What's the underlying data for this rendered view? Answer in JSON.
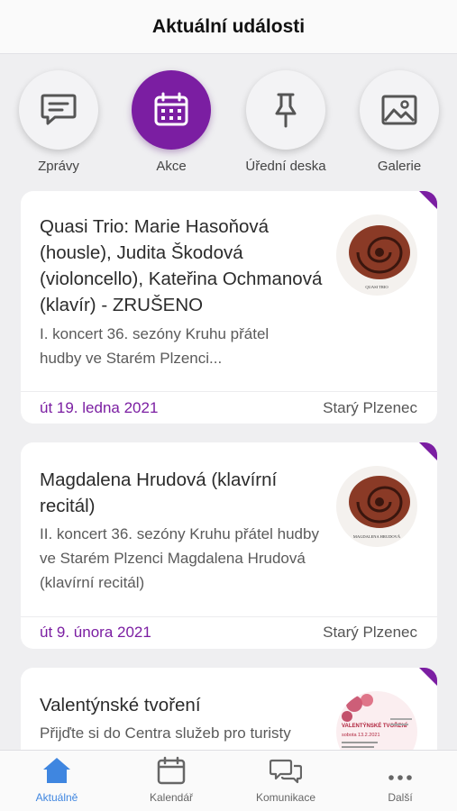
{
  "header": {
    "title": "Aktuální události"
  },
  "categories": [
    {
      "label": "Zprávy",
      "icon": "message-icon"
    },
    {
      "label": "Akce",
      "icon": "calendar-icon"
    },
    {
      "label": "Úřední deska",
      "icon": "pin-icon"
    },
    {
      "label": "Galerie",
      "icon": "image-icon"
    }
  ],
  "events": [
    {
      "title": "Quasi Trio: Marie Hasoňová (housle), Judita Škodová (violoncello), Kateřina Ochmanová (klavír) - ZRUŠENO",
      "description": "I. koncert 36. sezóny Kruhu přátel hudby ve Starém Plzenci...",
      "date": "út 19. ledna 2021",
      "place": "Starý Plzenec",
      "thumb_caption": "QUASI TRIO"
    },
    {
      "title": "Magdalena Hrudová (klavírní recitál)",
      "description": "II. koncert 36. sezóny Kruhu přátel hudby ve Starém Plzenci  Magdalena Hrudová (klavírní recitál)",
      "date": "út 9. února 2021",
      "place": "Starý Plzenec",
      "thumb_caption": "MAGDALENA HRUDOVÁ"
    },
    {
      "title": "Valentýnské tvoření",
      "description": "Přijďte si do Centra služeb pro turisty",
      "thumb_caption": "VALENTÝNSKÉ TVOŘENÍ",
      "thumb_date": "sobota 13.2.2021"
    }
  ],
  "nav": [
    {
      "label": "Aktuálně",
      "icon": "home-icon"
    },
    {
      "label": "Kalendář",
      "icon": "calendar-icon"
    },
    {
      "label": "Komunikace",
      "icon": "chat-icon"
    },
    {
      "label": "Další",
      "icon": "more-icon"
    }
  ],
  "colors": {
    "accent": "#7b1ea2",
    "nav_active": "#3f86e0"
  }
}
